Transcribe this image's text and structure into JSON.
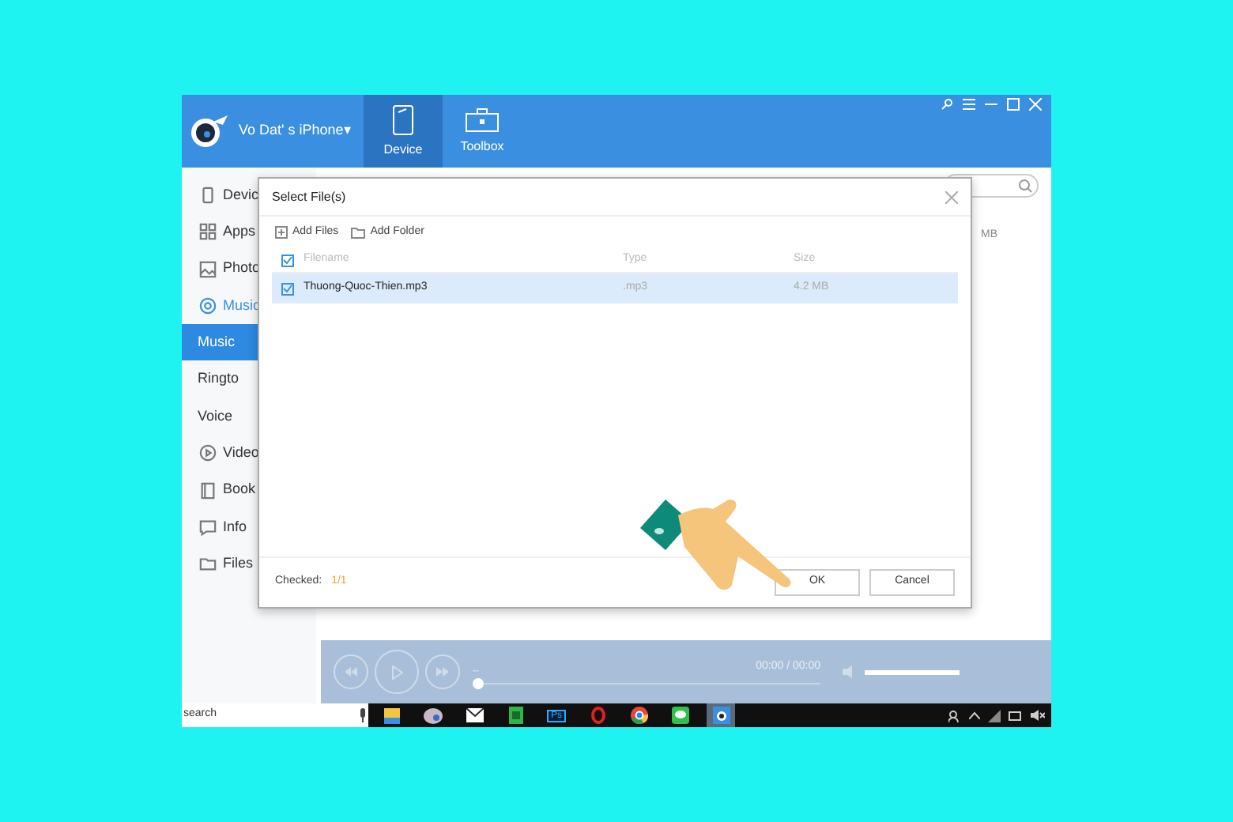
{
  "header": {
    "device_name": "Vo Dat' s iPhone",
    "dropdown": "▾",
    "tabs": [
      {
        "label": "Device",
        "selected": true,
        "kind": "device"
      },
      {
        "label": "Toolbox",
        "selected": false,
        "kind": "toolbox"
      }
    ]
  },
  "sidebar": {
    "items": [
      {
        "label": "Devic",
        "kind": "device",
        "selected": false
      },
      {
        "label": "Apps",
        "kind": "apps",
        "selected": false
      },
      {
        "label": "Photo",
        "kind": "photo",
        "selected": false
      },
      {
        "label": "Music",
        "kind": "music",
        "selected": true
      },
      {
        "label": "Music",
        "kind": "sub",
        "selected": true
      },
      {
        "label": "Ringto",
        "kind": "sub",
        "selected": false
      },
      {
        "label": "Voice",
        "kind": "sub",
        "selected": false
      },
      {
        "label": "Video",
        "kind": "video",
        "selected": false
      },
      {
        "label": "Book",
        "kind": "books",
        "selected": false
      },
      {
        "label": "Info",
        "kind": "info",
        "selected": false
      },
      {
        "label": "Files",
        "kind": "files",
        "selected": false
      }
    ]
  },
  "content": {
    "size_cell": "MB"
  },
  "dialog": {
    "title": "Select File(s)",
    "toolbar": [
      "Add Files",
      "Add Folder"
    ],
    "columns": [
      "Filename",
      "Type",
      "Size"
    ],
    "all_checked": true,
    "rows": [
      {
        "filename": "Thuong-Quoc-Thien.mp3",
        "type": ".mp3",
        "size": "4.2 MB",
        "checked": true,
        "selected": true
      }
    ],
    "checked_label": "Checked:",
    "checked_count": "1/1",
    "buttons": [
      "OK",
      "Cancel"
    ]
  },
  "player": {
    "marker": "--",
    "time": "00:00 / 00:00",
    "progress": {
      "level": 0
    },
    "volume": {
      "level": 1
    }
  },
  "taskbar": {
    "search": "search",
    "apps": [
      {
        "kind": "files"
      },
      {
        "kind": "disk"
      },
      {
        "kind": "mail"
      },
      {
        "kind": "green"
      },
      {
        "kind": "ps",
        "label": "Ps"
      },
      {
        "kind": "opera"
      },
      {
        "kind": "chrome"
      },
      {
        "kind": "line"
      },
      {
        "kind": "itools"
      }
    ]
  }
}
